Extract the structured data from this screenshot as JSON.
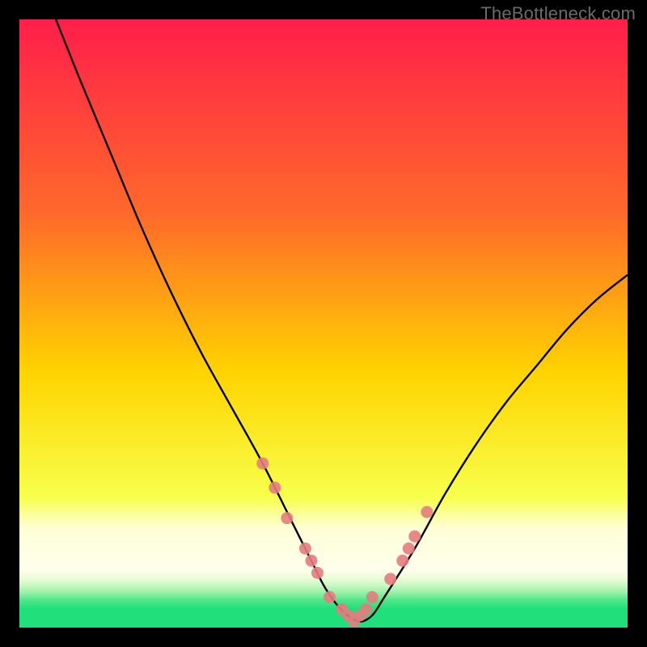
{
  "watermark": "TheBottleneck.com",
  "colors": {
    "top": "#ff1f4b",
    "mid_upper": "#ff6a2a",
    "mid": "#ffd400",
    "mid_lower": "#f8ff4a",
    "pale_band": "#ffffc0",
    "green": "#1fe07a",
    "frame": "#000000",
    "curve": "#000000",
    "marker": "#e47c80"
  },
  "chart_data": {
    "type": "line",
    "title": "",
    "xlabel": "",
    "ylabel": "",
    "xlim": [
      0,
      100
    ],
    "ylim": [
      0,
      100
    ],
    "grid": false,
    "legend": false,
    "annotations": [
      "TheBottleneck.com"
    ],
    "series": [
      {
        "name": "bottleneck-curve",
        "x": [
          6,
          10,
          15,
          20,
          25,
          30,
          35,
          40,
          45,
          48,
          50,
          52,
          54,
          56,
          58,
          60,
          65,
          70,
          75,
          80,
          85,
          90,
          95,
          100
        ],
        "y": [
          100,
          90,
          78,
          66,
          55,
          45,
          36,
          27,
          17,
          11,
          7,
          4,
          2,
          1,
          2,
          5,
          13,
          22,
          30,
          37,
          43,
          49,
          54,
          58
        ]
      }
    ],
    "markers": {
      "name": "highlighted-points",
      "x": [
        40,
        42,
        44,
        47,
        48,
        49,
        51,
        53,
        54,
        55,
        56,
        57,
        58,
        61,
        63,
        64,
        65,
        67
      ],
      "y": [
        27,
        23,
        18,
        13,
        11,
        9,
        5,
        3,
        2,
        1,
        2,
        3,
        5,
        8,
        11,
        13,
        15,
        19
      ]
    },
    "background_gradient_stops": [
      {
        "pct": 0,
        "color": "#ff1f4b"
      },
      {
        "pct": 32,
        "color": "#ff6a2a"
      },
      {
        "pct": 58,
        "color": "#ffd400"
      },
      {
        "pct": 78,
        "color": "#f8ff4a"
      },
      {
        "pct": 90,
        "color": "#ffffc0"
      },
      {
        "pct": 97,
        "color": "#1fe07a"
      }
    ]
  }
}
